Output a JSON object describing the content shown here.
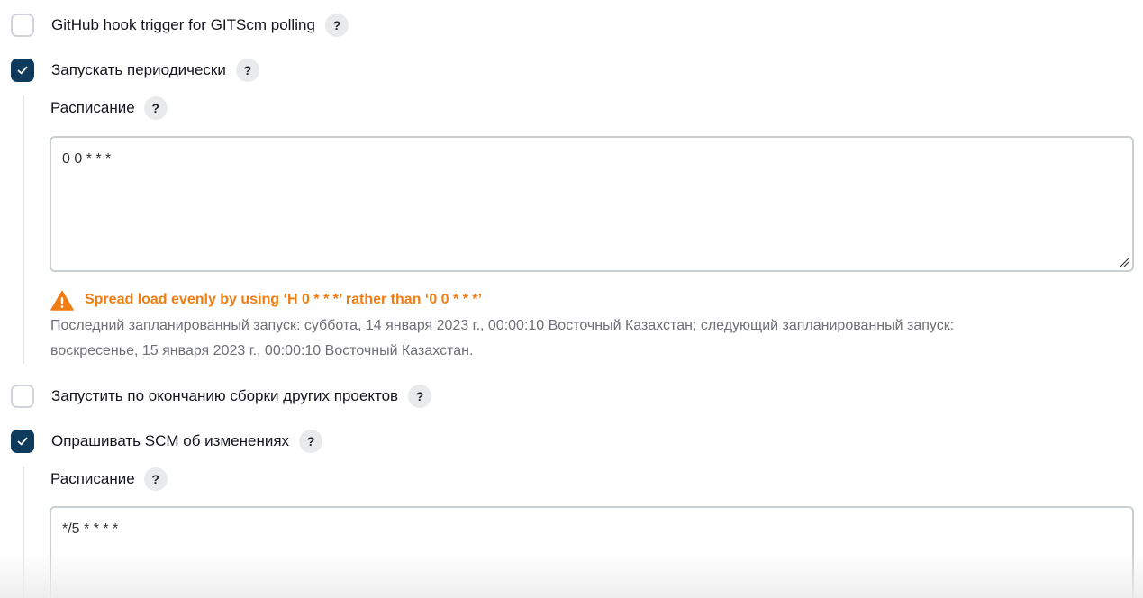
{
  "triggers": {
    "github_hook": {
      "label": "GitHub hook trigger for GITScm polling",
      "checked": false,
      "help": "?"
    },
    "periodic": {
      "label": "Запускать периодически",
      "checked": true,
      "help": "?",
      "schedule_label": "Расписание",
      "schedule_help": "?",
      "schedule_value": "0 0 * * *",
      "warning": "Spread load evenly by using ‘H 0 * * *’ rather than ‘0 0 * * *’",
      "info_line1": "Последний запланированный запуск: суббота, 14 января 2023 г., 00:00:10 Восточный Казахстан; следующий запланированный запуск:",
      "info_line2": "воскресенье, 15 января 2023 г., 00:00:10 Восточный Казахстан."
    },
    "after_other": {
      "label": "Запустить по окончанию сборки других проектов",
      "checked": false,
      "help": "?"
    },
    "poll_scm": {
      "label": "Опрашивать SCM об изменениях",
      "checked": true,
      "help": "?",
      "schedule_label": "Расписание",
      "schedule_help": "?",
      "schedule_value": "*/5 * * * *"
    }
  },
  "colors": {
    "checkbox_checked": "#0e3a5c",
    "warning": "#f07c12",
    "info_text": "#6e6f78"
  }
}
